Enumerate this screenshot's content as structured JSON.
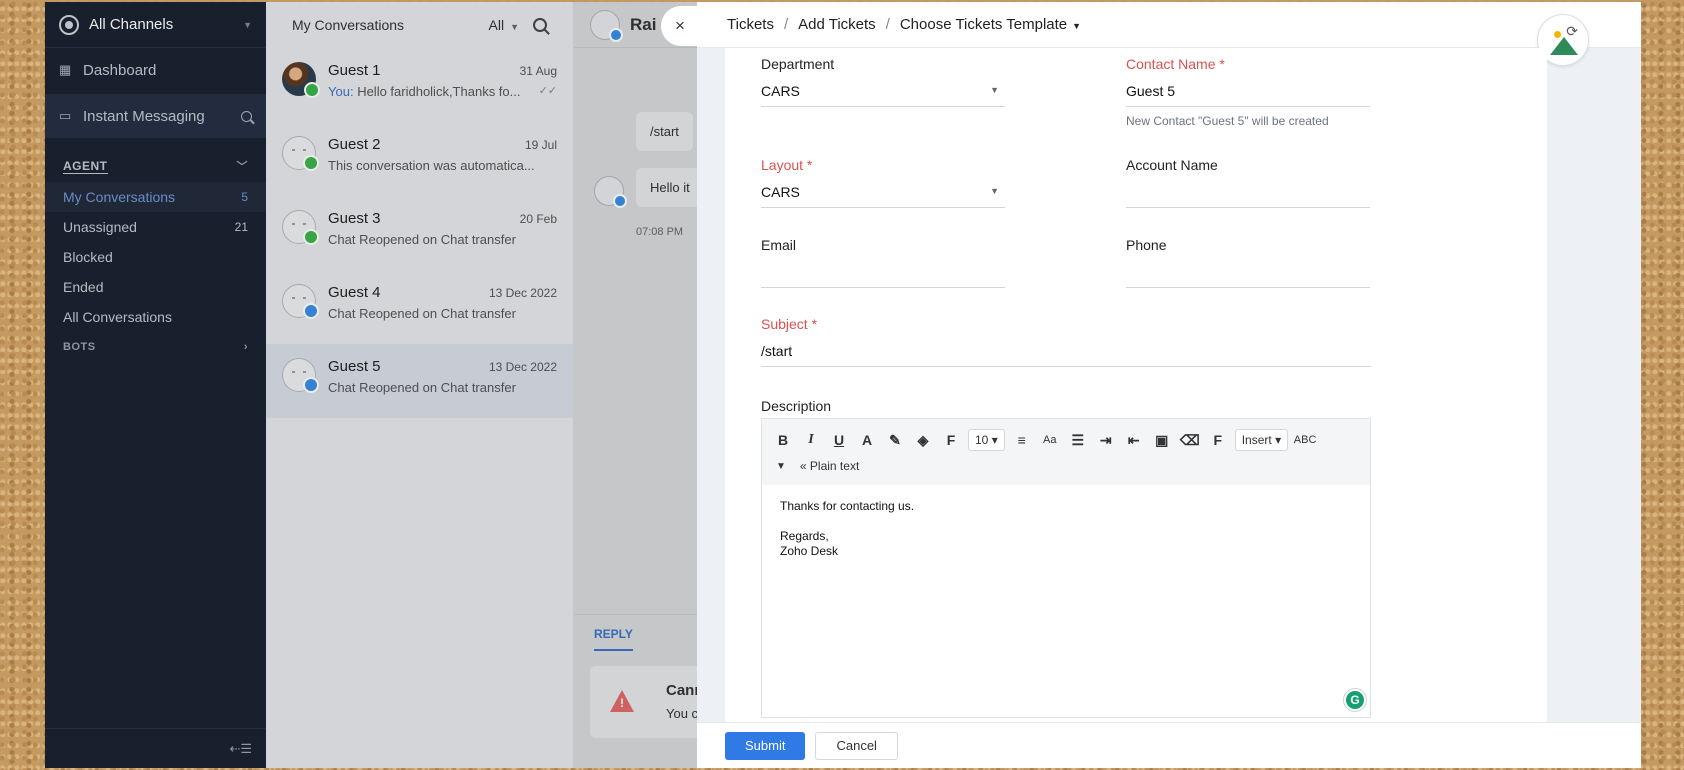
{
  "nav": {
    "channels_label": "All Channels",
    "dashboard_label": "Dashboard",
    "instant_messaging_label": "Instant Messaging",
    "agent_header": "AGENT",
    "items": [
      {
        "label": "My Conversations",
        "count": "5"
      },
      {
        "label": "Unassigned",
        "count": "21"
      },
      {
        "label": "Blocked",
        "count": ""
      },
      {
        "label": "Ended",
        "count": ""
      },
      {
        "label": "All Conversations",
        "count": ""
      }
    ],
    "bots_header": "BOTS",
    "collapse_glyph": "⇠☰"
  },
  "conversations": {
    "title": "My Conversations",
    "filter": "All",
    "list": [
      {
        "name": "Guest 1",
        "date": "31 Aug",
        "you": "You:",
        "preview": "Hello faridholick,Thanks fo...",
        "badge": "#3bb34a"
      },
      {
        "name": "Guest 2",
        "date": "19 Jul",
        "you": "",
        "preview": "This conversation was automatica...",
        "badge": "#3bb34a"
      },
      {
        "name": "Guest 3",
        "date": "20 Feb",
        "you": "",
        "preview": "Chat Reopened on Chat transfer",
        "badge": "#3bb34a"
      },
      {
        "name": "Guest 4",
        "date": "13 Dec 2022",
        "you": "",
        "preview": "Chat Reopened on Chat transfer",
        "badge": "#3a8ee6"
      },
      {
        "name": "Guest 5",
        "date": "13 Dec 2022",
        "you": "",
        "preview": "Chat Reopened on Chat transfer",
        "badge": "#3a8ee6"
      }
    ]
  },
  "chat": {
    "contact": "Rai",
    "message1": "/start",
    "message2": "Hello it",
    "time": "07:08 PM",
    "reply_tab": "REPLY",
    "warning_title": "Cann",
    "warning_text": "You c"
  },
  "panel": {
    "close_glyph": "×",
    "breadcrumb": [
      "Tickets",
      "Add Tickets",
      "Choose Tickets Template"
    ],
    "form": {
      "department": {
        "label": "Department",
        "value": "CARS"
      },
      "contact_name": {
        "label": "Contact Name",
        "value": "Guest 5",
        "hint": "New Contact \"Guest 5\" will be created"
      },
      "layout": {
        "label": "Layout",
        "value": "CARS"
      },
      "account_name": {
        "label": "Account Name",
        "value": ""
      },
      "email": {
        "label": "Email",
        "value": ""
      },
      "phone": {
        "label": "Phone",
        "value": ""
      },
      "subject": {
        "label": "Subject",
        "value": "/start"
      },
      "description": {
        "label": "Description",
        "font_size": "10",
        "insert_label": "Insert",
        "spell_label": "ABC",
        "plain_text_label": "« Plain text",
        "body_line1": "Thanks for contacting us.",
        "body_line2": "Regards,",
        "body_line3": "Zoho Desk"
      }
    },
    "submit_label": "Submit",
    "cancel_label": "Cancel"
  },
  "colors": {
    "nav_bg": "#1c2331",
    "accent": "#2f7ae5",
    "required": "#d9534f"
  }
}
